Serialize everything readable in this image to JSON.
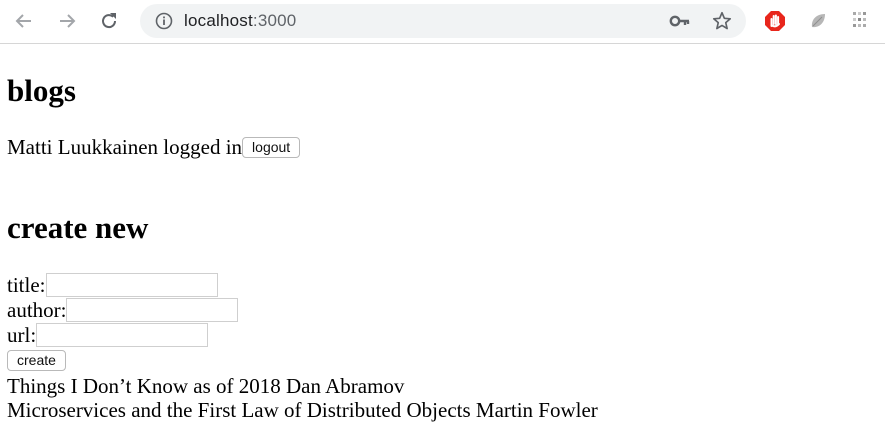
{
  "browser": {
    "url_host": "localhost",
    "url_port": ":3000",
    "icons": [
      "back-arrow-icon",
      "forward-arrow-icon",
      "reload-icon",
      "info-icon",
      "key-icon",
      "star-icon",
      "stop-extension-icon",
      "leaf-extension-icon",
      "grid-extension-icon"
    ],
    "colors": {
      "omnibox_bg": "#f1f3f4",
      "stop_red": "#e8261c"
    }
  },
  "app": {
    "title": "blogs",
    "user_line": "Matti Luukkainen logged in",
    "logout_label": "logout",
    "create_heading": "create new",
    "form": {
      "title_label": "title:",
      "title_value": "",
      "author_label": "author:",
      "author_value": "",
      "url_label": "url:",
      "url_value": "",
      "create_label": "create"
    },
    "blogs": [
      {
        "text": "Things I Don’t Know as of 2018 Dan Abramov"
      },
      {
        "text": "Microservices and the First Law of Distributed Objects Martin Fowler"
      }
    ]
  }
}
